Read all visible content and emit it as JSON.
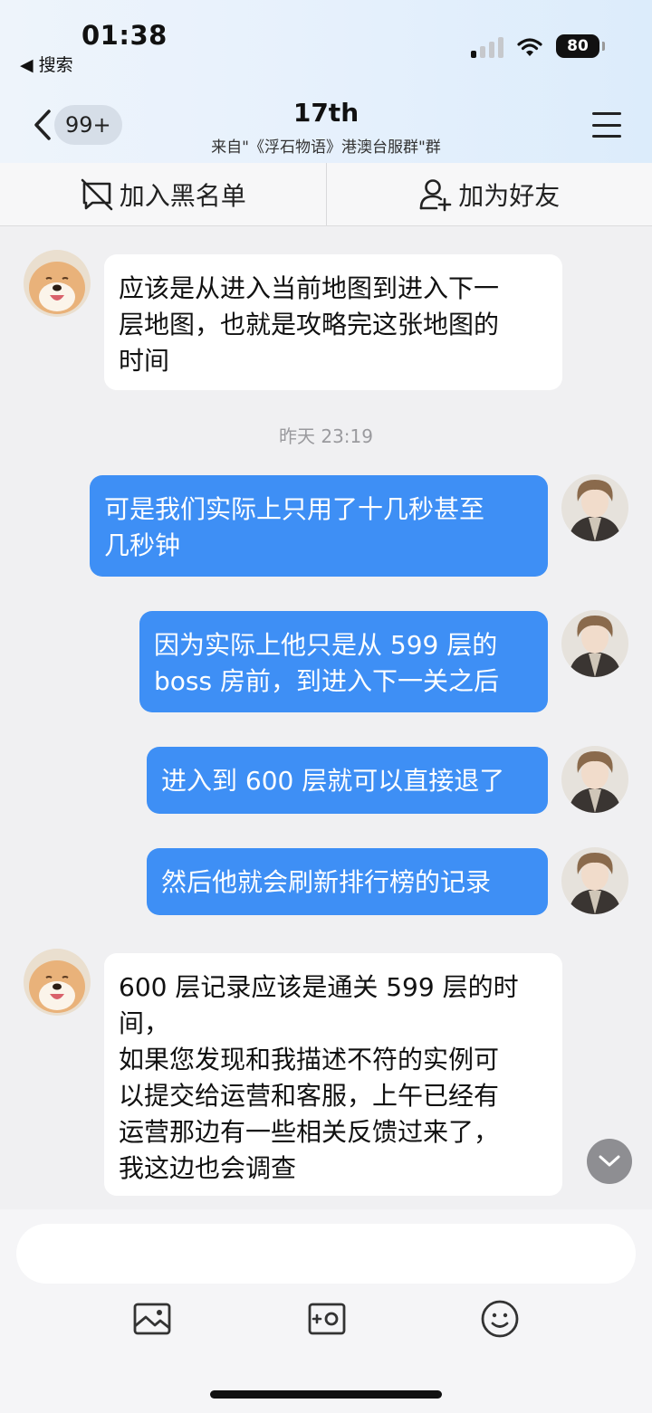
{
  "status_bar": {
    "time": "01:38",
    "back_label": "◀ 搜索",
    "battery": "80"
  },
  "nav": {
    "unread_count": "99+",
    "title": "17th",
    "subtitle": "来自\"《浮石物语》港澳台服群\"群"
  },
  "actions": {
    "blacklist": "加入黑名单",
    "add_friend": "加为好友"
  },
  "messages": [
    {
      "side": "left",
      "text": "应该是从进入当前地图到进入下一\n层地图，也就是攻略完这张地图的\n时间",
      "avatar": "dog-avatar"
    },
    {
      "side": "right",
      "text": "可是我们实际上只用了十几秒甚至\n几秒钟",
      "avatar": "anime-avatar"
    },
    {
      "side": "right",
      "text": "因为实际上他只是从 599 层的\nboss 房前，到进入下一关之后",
      "avatar": "anime-avatar"
    },
    {
      "side": "right",
      "text": "进入到 600 层就可以直接退了",
      "avatar": "anime-avatar"
    },
    {
      "side": "right",
      "text": "然后他就会刷新排行榜的记录",
      "avatar": "anime-avatar"
    },
    {
      "side": "left",
      "text": "600 层记录应该是通关 599 层的时\n间，\n如果您发现和我描述不符的实例可\n以提交给运营和客服，上午已经有\n运营那边有一些相关反馈过来了，\n我这边也会调查",
      "avatar": "dog-avatar"
    }
  ],
  "timestamp": "昨天 23:19",
  "colors": {
    "bubble_self": "#3e8ff5",
    "bubble_other": "#ffffff",
    "background": "#f0f0f2"
  }
}
